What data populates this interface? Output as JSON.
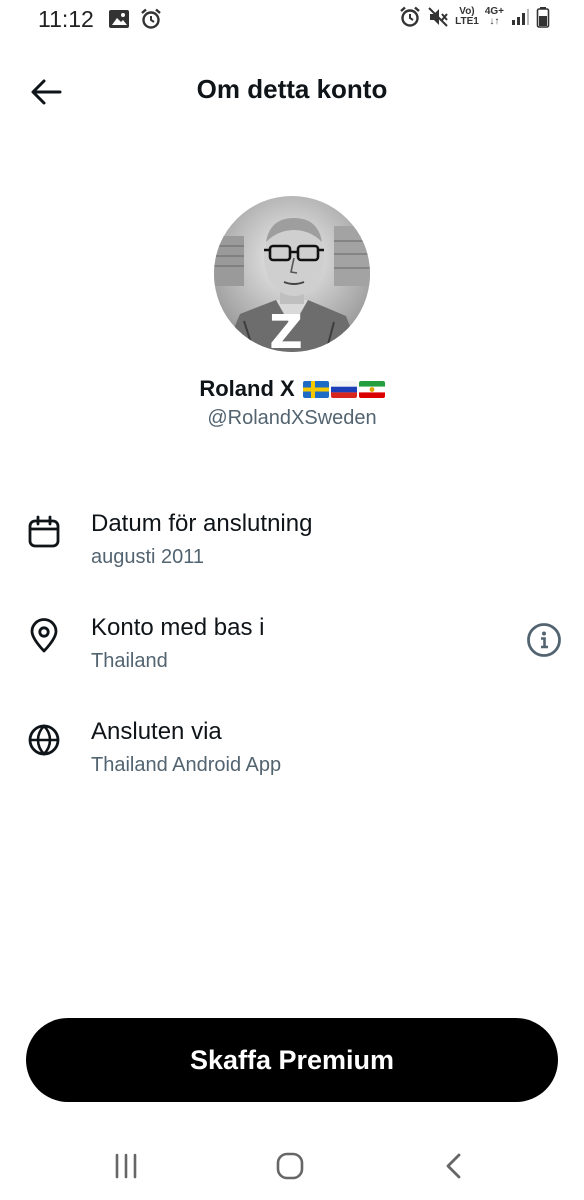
{
  "status_bar": {
    "time": "11:12",
    "network_top": "Vo)",
    "network_bottom": "LTE1",
    "network_gen": "4G+",
    "network_arrows": "↓↑"
  },
  "header": {
    "title": "Om detta konto"
  },
  "profile": {
    "display_name": "Roland X",
    "avatar_letter": "Z",
    "handle": "@RolandXSweden",
    "flags": [
      "sweden-flag",
      "russia-flag",
      "iran-lion-sun-flag"
    ]
  },
  "info": [
    {
      "icon": "calendar-icon",
      "title": "Datum för anslutning",
      "value": "augusti 2011"
    },
    {
      "icon": "location-pin-icon",
      "title": "Konto med bas i",
      "value": "Thailand"
    },
    {
      "icon": "globe-icon",
      "title": "Ansluten via",
      "value": "Thailand Android App"
    }
  ],
  "premium_button": {
    "label": "Skaffa Premium"
  },
  "colors": {
    "text_primary": "#0f1419",
    "text_secondary": "#536471",
    "button_bg": "#000000",
    "background": "#ffffff"
  },
  "nav_bar": {
    "icons": [
      "recents-icon",
      "home-icon",
      "back-icon"
    ]
  }
}
